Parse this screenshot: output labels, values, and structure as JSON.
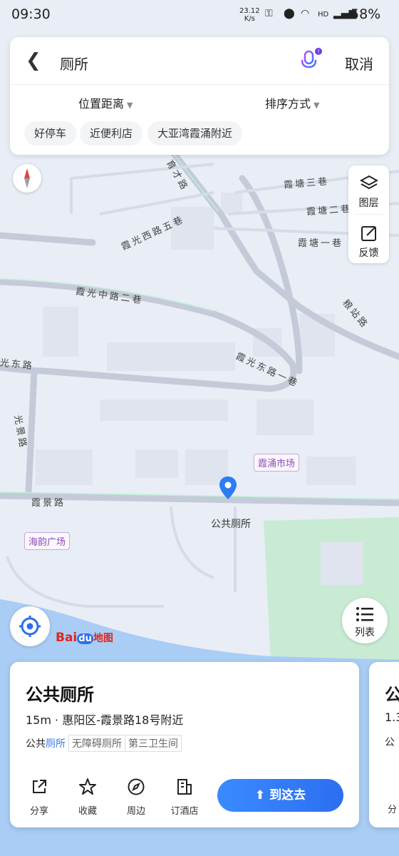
{
  "status_bar": {
    "time": "09:30",
    "net_speed_value": "23.12",
    "net_speed_unit": "K/s",
    "hd": "HD",
    "battery": "58%"
  },
  "search": {
    "query": "厕所",
    "cancel_label": "取消"
  },
  "filters": [
    {
      "label": "位置距离"
    },
    {
      "label": "排序方式"
    }
  ],
  "chips": [
    "好停车",
    "近便利店",
    "大亚湾霞涌附近"
  ],
  "side_panel": {
    "layers_label": "图层",
    "feedback_label": "反馈"
  },
  "map": {
    "streets": [
      "育才路",
      "霞塘三巷",
      "霞塘二巷",
      "霞塘一巷",
      "霞光西路五巷",
      "霞光中路二巷",
      "粮站路",
      "光东路",
      "霞光东路一巷",
      "光景路",
      "霞景路"
    ],
    "pois": [
      "霞涌市场",
      "海韵广场"
    ],
    "pin_label": "公共厕所"
  },
  "list_button_label": "列表",
  "logo": {
    "part1": "Bai",
    "part2": "du",
    "part3": "地图"
  },
  "result_card": {
    "title": "公共厕所",
    "address": "15m · 惠阳区-霞景路18号附近",
    "tag_prefix": "公共",
    "tag_highlight": "厕所",
    "tags": [
      "无障碍厕所",
      "第三卫生间"
    ],
    "actions": [
      "分享",
      "收藏",
      "周边",
      "订酒店"
    ],
    "go_label": "到这去"
  },
  "next_card": {
    "title": "公",
    "address": "1.3",
    "tag": "公",
    "action": "分"
  },
  "colors": {
    "accent": "#2c6ef0",
    "map_bg": "#e9edf5",
    "park": "#c9ebd4",
    "water": "#a9cdf5",
    "poi": "#8a4eb8"
  }
}
